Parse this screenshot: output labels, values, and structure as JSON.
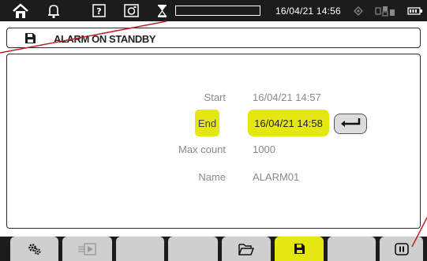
{
  "status_bar": {
    "icons": [
      "home-icon",
      "bell-icon",
      "help-icon",
      "screenshot-icon",
      "hourglass-icon"
    ],
    "progress_fraction": 0,
    "datetime": "16/04/21 14:56",
    "right_icons": [
      "connection-icon",
      "network-icon",
      "battery-icon"
    ]
  },
  "title": {
    "icon": "save-icon",
    "text": "ALARM ON STANDBY"
  },
  "form": {
    "start": {
      "label": "Start",
      "value": "16/04/21 14:57"
    },
    "end": {
      "label": "End",
      "value": "16/04/21 14:58"
    },
    "max_count": {
      "label": "Max count",
      "value": "1000"
    },
    "name": {
      "label": "Name",
      "value": "ALARM01"
    },
    "enter_icon": "enter-icon"
  },
  "tabs": [
    {
      "icon": "settings-gears-icon",
      "active": false
    },
    {
      "icon": "play-arrow-icon",
      "active": false,
      "disabled": true
    },
    {
      "icon": "",
      "active": false
    },
    {
      "icon": "",
      "active": false
    },
    {
      "icon": "folder-open-icon",
      "active": false
    },
    {
      "icon": "save-icon",
      "active": true
    },
    {
      "icon": "",
      "active": false
    },
    {
      "icon": "pause-icon",
      "active": false
    }
  ],
  "colors": {
    "highlight": "#e5e810",
    "annotation": "#c0202a",
    "bar": "#1c1c1c"
  }
}
